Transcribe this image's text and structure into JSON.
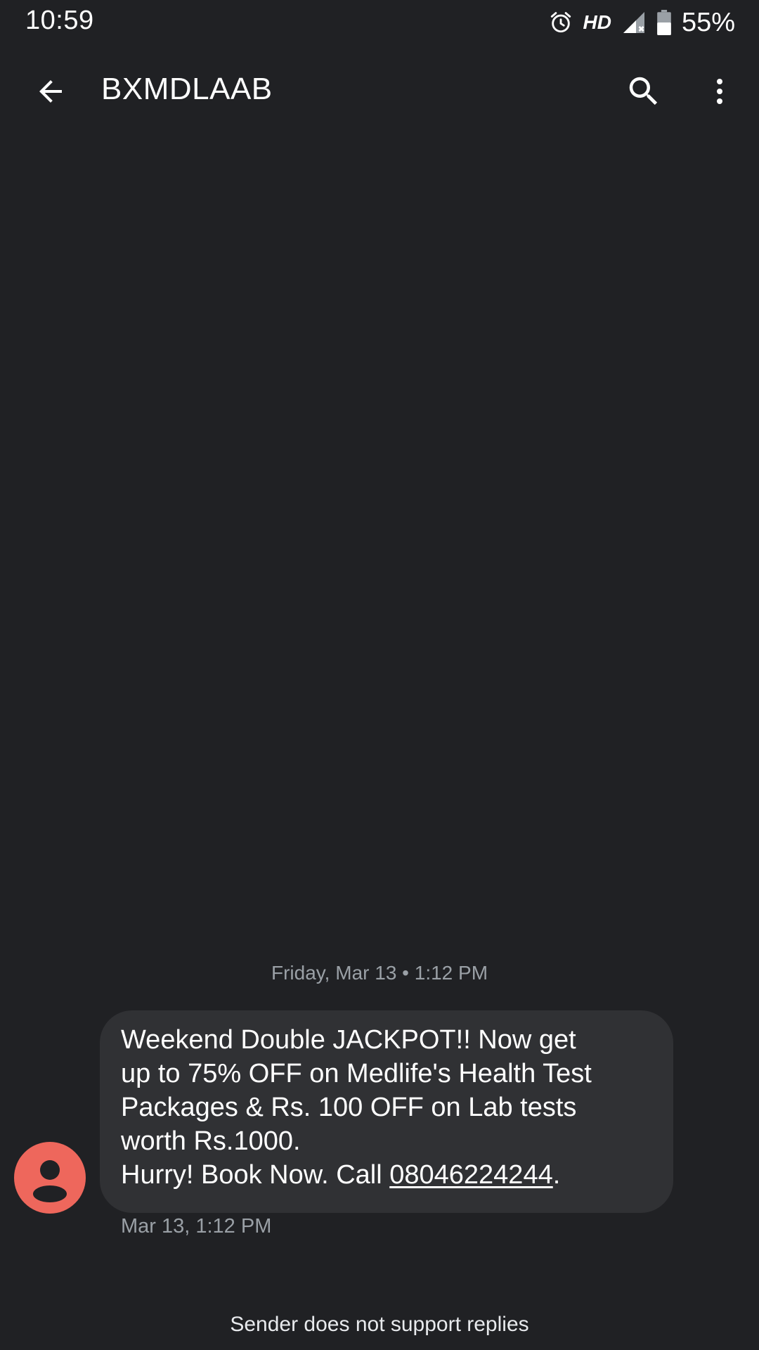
{
  "status_bar": {
    "time": "10:59",
    "network": "HD",
    "battery": "55%",
    "icons": [
      "alarm-icon",
      "signal-icon",
      "battery-icon"
    ]
  },
  "toolbar": {
    "title": "BXMDLAAB",
    "back_icon": "arrow-back-icon",
    "search_icon": "search-icon",
    "more_icon": "more-vert-icon"
  },
  "conversation": {
    "date_divider": "Friday, Mar 13 • 1:12 PM",
    "message": {
      "lines": [
        "Weekend Double JACKPOT!! Now get",
        "up to 75% OFF on Medlife's Health Test",
        "Packages & Rs. 100 OFF on Lab tests",
        "worth Rs.1000."
      ],
      "last_line_prefix": "Hurry! Book Now. Call ",
      "phone_number": "08046224244",
      "last_line_suffix": ".",
      "timestamp": "Mar 13, 1:12 PM"
    },
    "reply_notice": "Sender does not support replies"
  },
  "colors": {
    "background": "#202124",
    "bubble": "#303134",
    "avatar": "#ee675c",
    "secondary_text": "#9aa0a6"
  }
}
